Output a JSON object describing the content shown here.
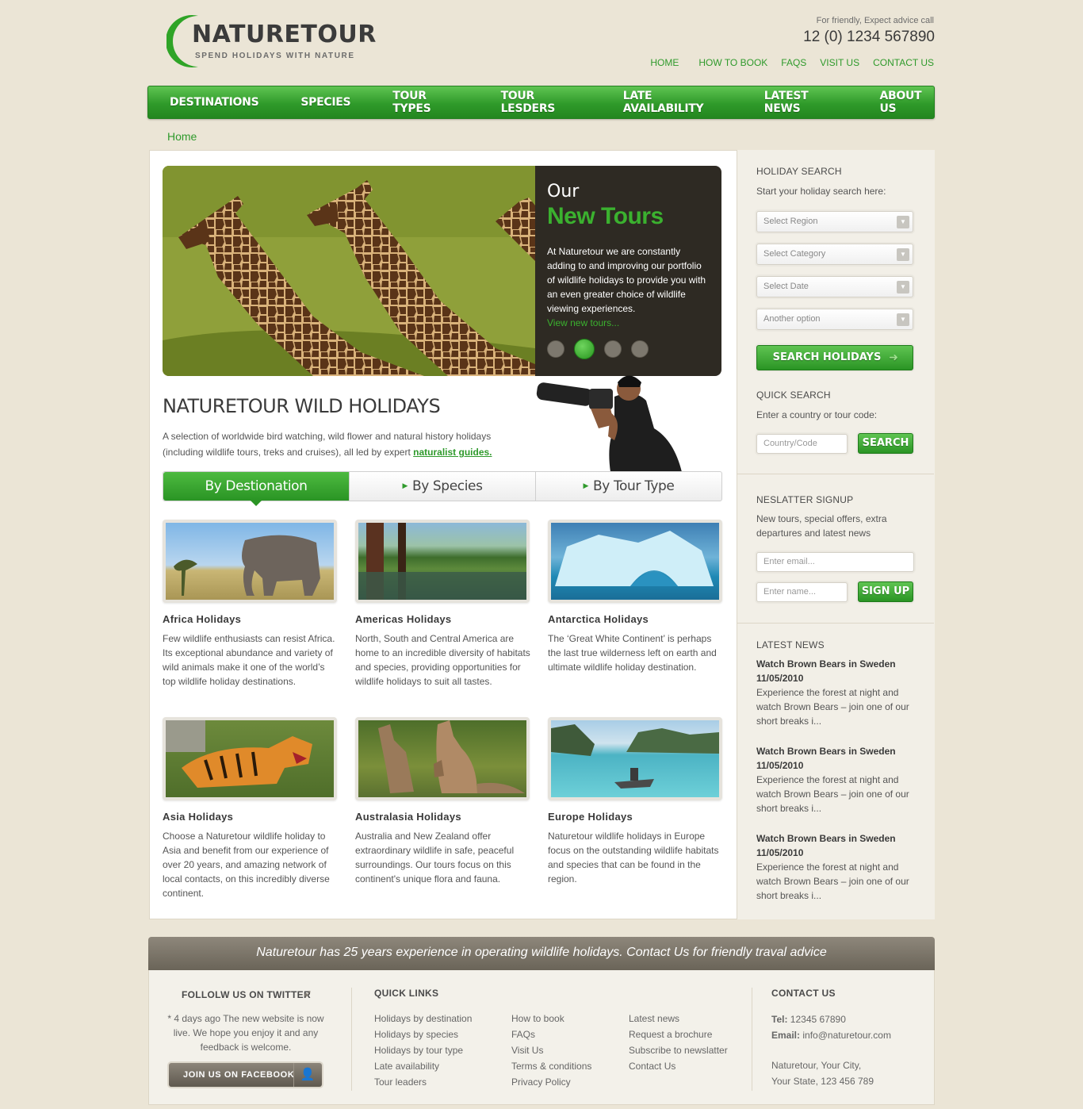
{
  "brand": {
    "name": "NATURETOUR",
    "tagline": "SPEND HOLIDAYS WITH NATURE"
  },
  "header": {
    "note": "For friendly, Expect advice call",
    "phone": "12 (0) 1234 567890",
    "links": [
      "HOME",
      "HOW TO BOOK",
      "FAQS",
      "VISIT US",
      "CONTACT US"
    ]
  },
  "nav": [
    "DESTINATIONS",
    "SPECIES",
    "TOUR TYPES",
    "TOUR LESDERS",
    "LATE AVAILABILITY",
    "LATEST NEWS",
    "ABOUT US"
  ],
  "breadcrumb": "Home",
  "slider": {
    "kicker": "Our",
    "title": "New Tours",
    "text": "At Naturetour we are constantly adding to and improving our portfolio of wildlife holidays to provide you with an even greater choice of wildlife viewing experiences.",
    "link": "View new tours...",
    "active_dot": 2,
    "dot_count": 4
  },
  "intro": {
    "heading": "NATURETOUR WILD HOLIDAYS",
    "text": "A selection of worldwide bird watching, wild flower and natural history holidays (including wildlife tours, treks and cruises), all led by expert",
    "link": "naturalist guides."
  },
  "tabs": [
    "By Destionation",
    "By Species",
    "By Tour Type"
  ],
  "cards": [
    {
      "title": "Africa Holidays",
      "text": "Few wildlife enthusiasts can resist Africa. Its exceptional abundance and variety of wild animals make it one of the world’s top wildlife holiday destinations."
    },
    {
      "title": "Americas Holidays",
      "text": "North, South and Central America are home to an incredible diversity of habitats and species, providing opportunities for wildlife holidays to suit all tastes."
    },
    {
      "title": "Antarctica Holidays",
      "text": "The ‘Great White Continent’ is perhaps the last true wilderness left on earth and ultimate wildlife holiday destination."
    },
    {
      "title": "Asia Holidays",
      "text": "Choose a Naturetour wildlife holiday to Asia and benefit from our experience of over 20 years, and amazing network of local contacts, on this incredibly diverse continent."
    },
    {
      "title": "Australasia Holidays",
      "text": "Australia and New Zealand offer extraordinary wildlife in safe, peaceful surroundings. Our tours focus on this continent's unique flora and fauna."
    },
    {
      "title": "Europe Holidays",
      "text": "Naturetour wildlife holidays in Europe focus on the outstanding wildlife habitats and species that can be found in the region."
    }
  ],
  "holiday_search": {
    "heading": "HOLIDAY SEARCH",
    "subtitle": "Start your holiday search here:",
    "selects": [
      "Select Region",
      "Select Category",
      "Select Date",
      "Another option"
    ],
    "button": "SEARCH HOLIDAYS"
  },
  "quick_search": {
    "heading": "QUICK SEARCH",
    "subtitle": "Enter a country or tour code:",
    "placeholder": "Country/Code",
    "button": "SEARCH"
  },
  "newsletter": {
    "heading": "NESLATTER SIGNUP",
    "subtitle": "New tours, special offers, extra departures and latest news",
    "email_placeholder": "Enter email...",
    "name_placeholder": "Enter name...",
    "button": "SIGN UP"
  },
  "latest_news": {
    "heading": "LATEST NEWS",
    "items": [
      {
        "title": "Watch Brown Bears in Sweden",
        "date": "11/05/2010",
        "text": "Experience the forest at night and watch Brown Bears – join one of our short breaks i..."
      },
      {
        "title": "Watch Brown Bears in Sweden",
        "date": "11/05/2010",
        "text": "Experience the forest at night and watch Brown Bears – join one of our short breaks i..."
      },
      {
        "title": "Watch Brown Bears in Sweden",
        "date": "11/05/2010",
        "text": "Experience the forest at night and watch Brown Bears – join one of our short breaks i..."
      }
    ]
  },
  "footer": {
    "banner": "Naturetour has 25 years experience in operating wildlife holidays. Contact Us for friendly traval advice",
    "twitter": {
      "heading": "FOLLOLW US ON TWITTER",
      "text": "* 4 days ago The new website is now live. We hope you enjoy it and any feedback is welcome.",
      "button": "JOIN US ON FACEBOOK"
    },
    "quick_links": {
      "heading": "QUICK LINKS",
      "col1": [
        "Holidays by destination",
        "Holidays by species",
        "Holidays by tour type",
        "Late availability",
        "Tour leaders"
      ],
      "col2": [
        "How to book",
        "FAQs",
        "Visit Us",
        "Terms & conditions",
        "Privacy Policy"
      ],
      "col3": [
        "Latest news",
        "Request a brochure",
        "Subscribe to newslatter",
        "Contact Us"
      ]
    },
    "contact": {
      "heading": "CONTACT US",
      "tel_label": "Tel:",
      "tel": "12345 67890",
      "email_label": "Email:",
      "email": "info@naturetour.com",
      "address1": "Naturetour, Your City,",
      "address2": "Your State, 123 456 789"
    }
  },
  "colors": {
    "accent": "#2f9a2c",
    "background": "#ebe5d6",
    "footer_bar": "#7a7468"
  }
}
